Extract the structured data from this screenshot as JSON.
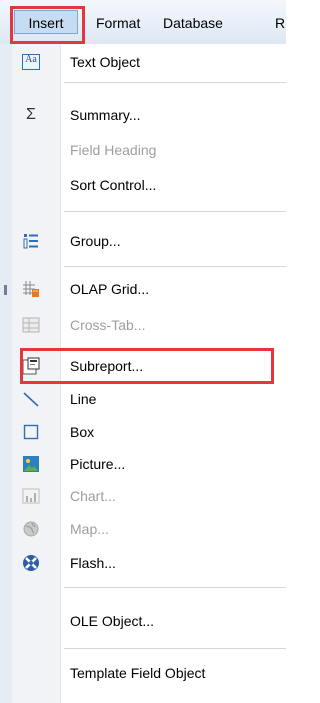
{
  "menubar": {
    "items": [
      {
        "label": "Insert"
      },
      {
        "label": "Format"
      },
      {
        "label": "Database"
      },
      {
        "label": "R"
      }
    ]
  },
  "menu": {
    "items": [
      {
        "label": "Text Object",
        "icon": "text-object-icon",
        "enabled": true
      },
      {
        "label": "Summary...",
        "icon": "sigma-icon",
        "enabled": true
      },
      {
        "label": "Field Heading",
        "icon": "",
        "enabled": false
      },
      {
        "label": "Sort Control...",
        "icon": "",
        "enabled": true
      },
      {
        "label": "Group...",
        "icon": "group-icon",
        "enabled": true
      },
      {
        "label": "OLAP Grid...",
        "icon": "olap-grid-icon",
        "enabled": true
      },
      {
        "label": "Cross-Tab...",
        "icon": "cross-tab-icon",
        "enabled": false
      },
      {
        "label": "Subreport...",
        "icon": "subreport-icon",
        "enabled": true
      },
      {
        "label": "Line",
        "icon": "line-icon",
        "enabled": true
      },
      {
        "label": "Box",
        "icon": "box-icon",
        "enabled": true
      },
      {
        "label": "Picture...",
        "icon": "picture-icon",
        "enabled": true
      },
      {
        "label": "Chart...",
        "icon": "chart-icon",
        "enabled": false
      },
      {
        "label": "Map...",
        "icon": "map-icon",
        "enabled": false
      },
      {
        "label": "Flash...",
        "icon": "flash-icon",
        "enabled": true
      },
      {
        "label": "OLE Object...",
        "icon": "",
        "enabled": true
      },
      {
        "label": "Template Field Object",
        "icon": "",
        "enabled": true
      }
    ],
    "text_object_icon_text": "Aa",
    "summary_icon_text": "Σ"
  },
  "highlight_color": "#e4373b"
}
